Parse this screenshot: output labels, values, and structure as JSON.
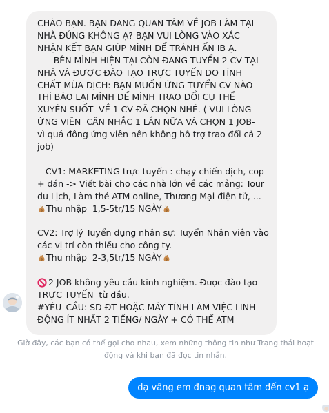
{
  "incoming_message": {
    "lines": [
      "CHÀO BẠN. BẠN ĐANG QUAN TÂM VỀ JOB LÀM TẠI",
      "NHÀ ĐÚNG KHÔNG Ạ? BẠN VUI LÒNG VÀO XÁC",
      "NHẬN KẾT BẠN GIÚP MÌNH ĐỂ TRÁNH ẨN IB Ạ.",
      "      BÊN MÌNH HIỆN TẠI CÒN ĐANG TUYỂN 2 CV TẠI",
      "NHÀ VÀ ĐƯỢC ĐÀO TẠO TRỰC TUYẾN DO TÍNH",
      "CHẤT MÙA DỊCH: BẠN MUỐN ỨNG TUYỂN CV NÀO",
      "THÌ BÁO LẠI MÌNH ĐỂ MÌNH TRAO ĐỔI CỤ THỂ",
      "XUYÊN SUỐT  VỀ 1 CV ĐÃ CHỌN NHÉ. ( VUI LÒNG",
      "ỨNG VIÊN  CÂN NHẮC 1 LẦN NỮA VÀ CHỌN 1 JOB-",
      "vì quá đông ứng viên nên không hỗ trợ trao đổi cả 2",
      "job)",
      "",
      "   CV1: MARKETING trực tuyến : chạy chiến dịch, cop",
      "+ dán -> Viết bài cho các nhà lớn về các mảng: Tour",
      "du Lịch, Làm thẻ ATM online, Thương Mại điện tử, ..."
    ],
    "cv1_income": "Thu nhập  1,5-5tr/15 NGÀY",
    "cv2_lines": [
      "CV2: Trợ lý Tuyển dụng nhân sự: Tuyển Nhân viên vào",
      "các vị trí còn thiếu cho công ty."
    ],
    "cv2_income": "Thu nhập  2-3,5tr/15 NGÀY",
    "requirements_first": "2 JOB không yêu cầu kinh nghiệm. Được đào tạo",
    "requirements_lines": [
      "TRỰC TUYẾN  từ đầu.",
      "#YÊU_CẦU: SD ĐT HOẶC MÁY TÍNH LÀM VIỆC LINH",
      "ĐỘNG ÍT NHẤT 2 TIẾNG/ NGÀY + CÓ THỂ ATM"
    ],
    "icons": {
      "money": "money-bag-icon",
      "no_entry": "no-entry-icon"
    }
  },
  "system_notice": {
    "line1": "Giờ đây, các bạn có thể gọi cho nhau, xem những thông tin như Trạng thái hoạt",
    "line2": "động và khi bạn đã đọc tin nhắn."
  },
  "outgoing_message": {
    "text": "dạ vâng em đnag quan tâm đến cv1 ạ"
  },
  "colors": {
    "incoming_bubble": "#f1f0f0",
    "outgoing_bubble": "#0084ff",
    "notice_text": "#8d949e",
    "message_text": "#1c1e21"
  }
}
